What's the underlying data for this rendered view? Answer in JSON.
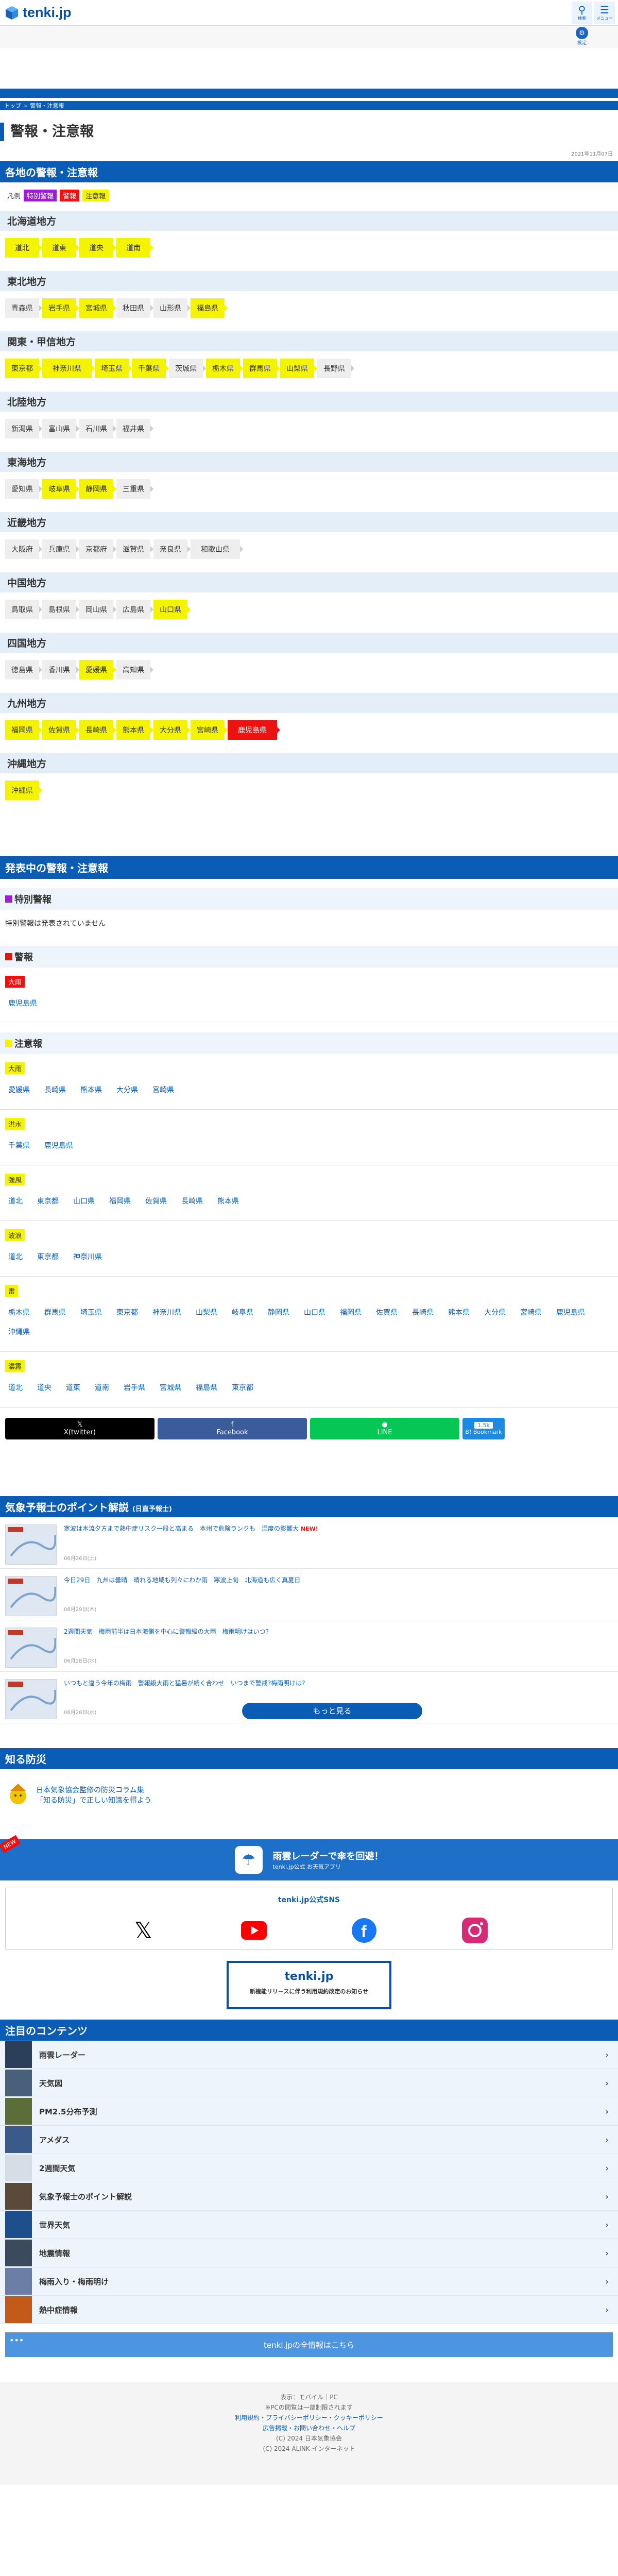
{
  "header": {
    "logo": "tenki.jp",
    "search_label": "検索",
    "menu_label": "メニュー",
    "settings_label": "設定"
  },
  "breadcrumb": [
    "トップ",
    "警報・注意報"
  ],
  "page": {
    "title": "警報・注意報",
    "date": "2021年11月07日"
  },
  "regions_section": {
    "title": "各地の警報・注意報",
    "legend_label": "凡例",
    "legend": [
      "特別警報",
      "警報",
      "注意報"
    ],
    "regions": [
      {
        "name": "北海道地方",
        "prefs": [
          {
            "n": "道北",
            "l": "ad"
          },
          {
            "n": "道東",
            "l": "ad"
          },
          {
            "n": "道央",
            "l": "ad"
          },
          {
            "n": "道南",
            "l": "ad"
          }
        ]
      },
      {
        "name": "東北地方",
        "prefs": [
          {
            "n": "青森県",
            "l": ""
          },
          {
            "n": "岩手県",
            "l": "ad"
          },
          {
            "n": "宮城県",
            "l": "ad"
          },
          {
            "n": "秋田県",
            "l": ""
          },
          {
            "n": "山形県",
            "l": ""
          },
          {
            "n": "福島県",
            "l": "ad"
          }
        ]
      },
      {
        "name": "関東・甲信地方",
        "prefs": [
          {
            "n": "東京都",
            "l": "ad"
          },
          {
            "n": "神奈川県",
            "l": "ad"
          },
          {
            "n": "埼玉県",
            "l": "ad"
          },
          {
            "n": "千葉県",
            "l": "ad"
          },
          {
            "n": "茨城県",
            "l": ""
          },
          {
            "n": "栃木県",
            "l": "ad"
          },
          {
            "n": "群馬県",
            "l": "ad"
          },
          {
            "n": "山梨県",
            "l": "ad"
          },
          {
            "n": "長野県",
            "l": ""
          }
        ]
      },
      {
        "name": "北陸地方",
        "prefs": [
          {
            "n": "新潟県",
            "l": ""
          },
          {
            "n": "富山県",
            "l": ""
          },
          {
            "n": "石川県",
            "l": ""
          },
          {
            "n": "福井県",
            "l": ""
          }
        ]
      },
      {
        "name": "東海地方",
        "prefs": [
          {
            "n": "愛知県",
            "l": ""
          },
          {
            "n": "岐阜県",
            "l": "ad"
          },
          {
            "n": "静岡県",
            "l": "ad"
          },
          {
            "n": "三重県",
            "l": ""
          }
        ]
      },
      {
        "name": "近畿地方",
        "prefs": [
          {
            "n": "大阪府",
            "l": ""
          },
          {
            "n": "兵庫県",
            "l": ""
          },
          {
            "n": "京都府",
            "l": ""
          },
          {
            "n": "滋賀県",
            "l": ""
          },
          {
            "n": "奈良県",
            "l": ""
          },
          {
            "n": "和歌山県",
            "l": ""
          }
        ]
      },
      {
        "name": "中国地方",
        "prefs": [
          {
            "n": "鳥取県",
            "l": ""
          },
          {
            "n": "島根県",
            "l": ""
          },
          {
            "n": "岡山県",
            "l": ""
          },
          {
            "n": "広島県",
            "l": ""
          },
          {
            "n": "山口県",
            "l": "ad"
          }
        ]
      },
      {
        "name": "四国地方",
        "prefs": [
          {
            "n": "徳島県",
            "l": ""
          },
          {
            "n": "香川県",
            "l": ""
          },
          {
            "n": "愛媛県",
            "l": "ad"
          },
          {
            "n": "高知県",
            "l": ""
          }
        ]
      },
      {
        "name": "九州地方",
        "prefs": [
          {
            "n": "福岡県",
            "l": "ad"
          },
          {
            "n": "佐賀県",
            "l": "ad"
          },
          {
            "n": "長崎県",
            "l": "ad"
          },
          {
            "n": "熊本県",
            "l": "ad"
          },
          {
            "n": "大分県",
            "l": "ad"
          },
          {
            "n": "宮崎県",
            "l": "ad"
          },
          {
            "n": "鹿児島県",
            "l": "wa"
          }
        ]
      },
      {
        "name": "沖縄地方",
        "prefs": [
          {
            "n": "沖縄県",
            "l": "ad"
          }
        ]
      }
    ]
  },
  "active_section": {
    "title": "発表中の警報・注意報",
    "special": {
      "title": "特別警報",
      "none_text": "特別警報は発表されていません"
    },
    "warning": {
      "title": "警報",
      "groups": [
        {
          "label": "大雨",
          "links": [
            "鹿児島県"
          ]
        }
      ]
    },
    "advisory": {
      "title": "注意報",
      "groups": [
        {
          "label": "大雨",
          "links": [
            "愛媛県",
            "長崎県",
            "熊本県",
            "大分県",
            "宮崎県"
          ]
        },
        {
          "label": "洪水",
          "links": [
            "千葉県",
            "鹿児島県"
          ]
        },
        {
          "label": "強風",
          "links": [
            "道北",
            "東京都",
            "山口県",
            "福岡県",
            "佐賀県",
            "長崎県",
            "熊本県"
          ]
        },
        {
          "label": "波浪",
          "links": [
            "道北",
            "東京都",
            "神奈川県"
          ]
        },
        {
          "label": "雷",
          "links": [
            "栃木県",
            "群馬県",
            "埼玉県",
            "東京都",
            "神奈川県",
            "山梨県",
            "岐阜県",
            "静岡県",
            "山口県",
            "福岡県",
            "佐賀県",
            "長崎県",
            "熊本県",
            "大分県",
            "宮崎県",
            "鹿児島県",
            "沖縄県"
          ]
        },
        {
          "label": "濃霧",
          "links": [
            "道北",
            "道央",
            "道東",
            "道南",
            "岩手県",
            "宮城県",
            "福島県",
            "東京都"
          ]
        }
      ]
    }
  },
  "share": {
    "x": "X(twitter)",
    "fb": "Facebook",
    "line": "LINE",
    "hb_count": "1.5k",
    "hb": "B! Bookmark"
  },
  "points": {
    "title": "気象予報士のポイント解説",
    "title_sub": "(日直予報士)",
    "articles": [
      {
        "title": "寒波は本流夕方まで熱中症リスク一段と高まる　本州で危険ランクも　湿度の影響大",
        "new": "NEW!",
        "date": "06月26日(土)"
      },
      {
        "title": "今日29日　九州は曇晴　晴れる地域も列々にわか雨　寒波上旬　北海道も広く真夏日",
        "new": "",
        "date": "06月29日(木)"
      },
      {
        "title": "2週間天気　梅雨前半は日本海側を中心に警報級の大雨　梅雨明けはいつ?",
        "new": "",
        "date": "06月28日(水)"
      },
      {
        "title": "いつもと違う今年の梅雨　警報級大雨と猛暑が続く合わせ　いつまで警戒?梅雨明けは?",
        "new": "",
        "date": "06月28日(水)"
      }
    ],
    "more": "もっと見る"
  },
  "shiru": {
    "title": "知る防災",
    "line1": "日本気象協会監修の防災コラム集",
    "line2": "「知る防災」で正しい知識を得よう"
  },
  "banner": {
    "badge": "NEW",
    "title": "雨雲レーダーで傘を回避！",
    "sub": "tenki.jp公式 お天気アプリ"
  },
  "sns": {
    "title": "tenki.jp公式SNS"
  },
  "app": {
    "logo": "tenki.jp",
    "text": "新機能リリースに伴う利用規約改定のお知らせ"
  },
  "featured": {
    "title": "注目のコンテンツ",
    "items": [
      "雨雲レーダー",
      "天気図",
      "PM2.5分布予測",
      "アメダス",
      "2週間天気",
      "気象予報士のポイント解説",
      "世界天気",
      "地震情報",
      "梅雨入り・梅雨明け",
      "熱中症情報"
    ],
    "all": "tenki.jpの全情報はこちら"
  },
  "footer": {
    "line1": "表示：モバイル｜PC",
    "line2": "※PCの閲覧は一部制限されます",
    "line3": "利用規約・プライバシーポリシー・クッキーポリシー",
    "line4": "広告掲載・お問い合わせ・ヘルプ",
    "line5": "(C) 2024 日本気象協会",
    "line6": "(C) 2024 ALINK インターネット"
  }
}
